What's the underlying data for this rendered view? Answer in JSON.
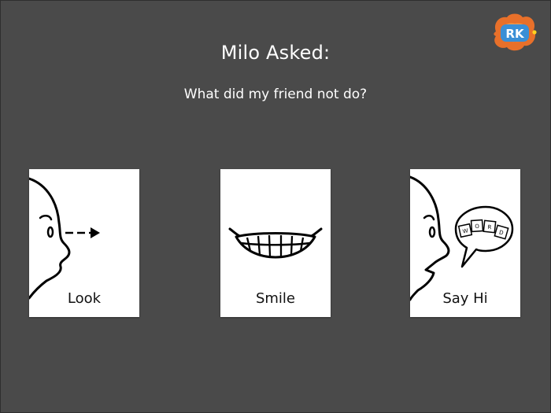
{
  "header": {
    "title": "Milo Asked:",
    "question": "What did my friend not do?"
  },
  "logo": {
    "text": "RK",
    "icon": "rk-logo-icon",
    "colors": {
      "splash": "#e8702a",
      "badge": "#3a8fd6",
      "dot": "#ffd21f"
    }
  },
  "options": [
    {
      "label": "Look",
      "icon": "face-looking-arrow-icon"
    },
    {
      "label": "Smile",
      "icon": "smiling-mouth-icon"
    },
    {
      "label": "Say Hi",
      "icon": "face-speech-bubble-word-icon"
    }
  ],
  "speech_bubble_letters": [
    "W",
    "O",
    "R",
    "D"
  ]
}
